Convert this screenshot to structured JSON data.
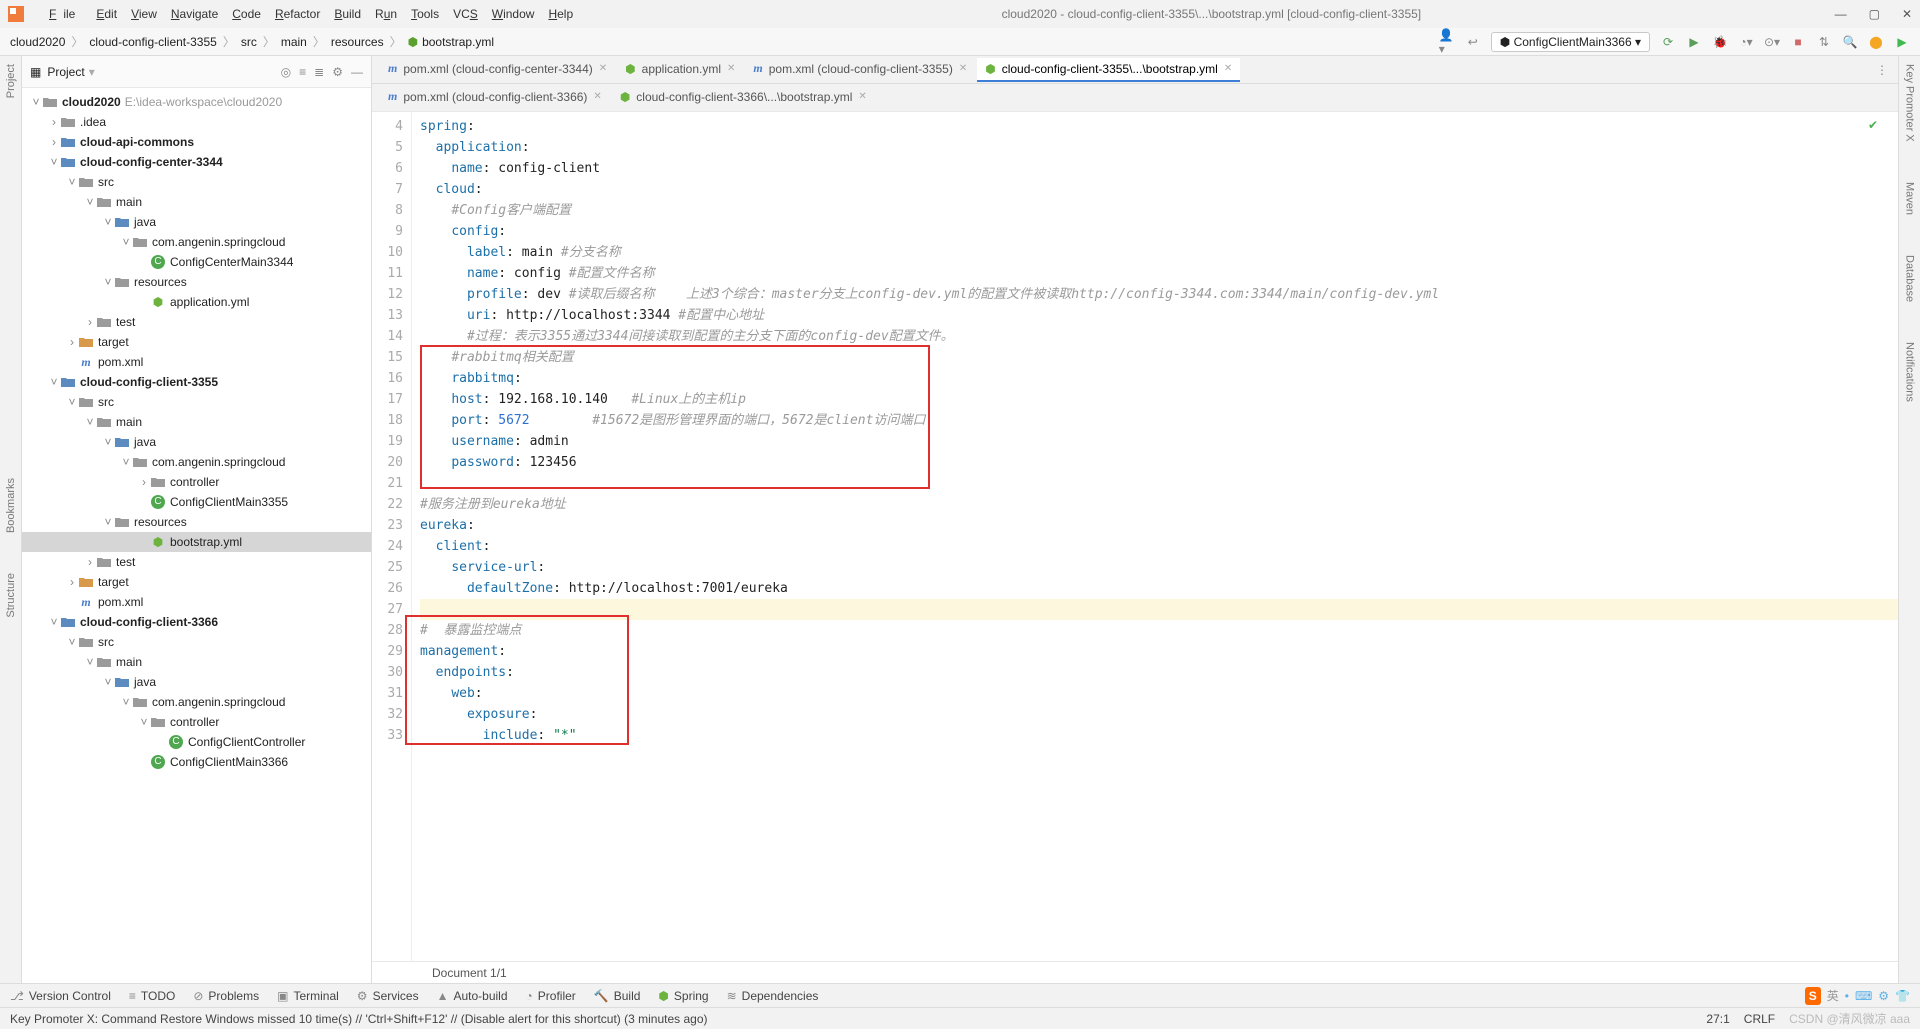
{
  "title": "cloud2020 - cloud-config-client-3355\\...\\bootstrap.yml [cloud-config-client-3355]",
  "menu": {
    "file": "File",
    "edit": "Edit",
    "view": "View",
    "navigate": "Navigate",
    "code": "Code",
    "refactor": "Refactor",
    "build": "Build",
    "run": "Run",
    "tools": "Tools",
    "vcs": "VCS",
    "window": "Window",
    "help": "Help"
  },
  "breadcrumb": [
    "cloud2020",
    "cloud-config-client-3355",
    "src",
    "main",
    "resources",
    "bootstrap.yml"
  ],
  "run_config": "ConfigClientMain3366",
  "project_header": "Project",
  "tree": {
    "root": "cloud2020",
    "root_path": "E:\\idea-workspace\\cloud2020",
    "items": [
      {
        "indent": 1,
        "arrow": ">",
        "icon": "folder-gray",
        "label": ".idea"
      },
      {
        "indent": 1,
        "arrow": ">",
        "icon": "folder-blue",
        "label": "cloud-api-commons",
        "bold": true
      },
      {
        "indent": 1,
        "arrow": "v",
        "icon": "folder-blue",
        "label": "cloud-config-center-3344",
        "bold": true
      },
      {
        "indent": 2,
        "arrow": "v",
        "icon": "folder-gray",
        "label": "src"
      },
      {
        "indent": 3,
        "arrow": "v",
        "icon": "folder-gray",
        "label": "main"
      },
      {
        "indent": 4,
        "arrow": "v",
        "icon": "folder-blue",
        "label": "java"
      },
      {
        "indent": 5,
        "arrow": "v",
        "icon": "folder-gray",
        "label": "com.angenin.springcloud"
      },
      {
        "indent": 6,
        "arrow": "",
        "icon": "c",
        "label": "ConfigCenterMain3344"
      },
      {
        "indent": 4,
        "arrow": "v",
        "icon": "folder-gray",
        "label": "resources"
      },
      {
        "indent": 6,
        "arrow": "",
        "icon": "leaf",
        "label": "application.yml"
      },
      {
        "indent": 3,
        "arrow": ">",
        "icon": "folder-gray",
        "label": "test"
      },
      {
        "indent": 2,
        "arrow": ">",
        "icon": "folder-brown",
        "label": "target"
      },
      {
        "indent": 2,
        "arrow": "",
        "icon": "m",
        "label": "pom.xml"
      },
      {
        "indent": 1,
        "arrow": "v",
        "icon": "folder-blue",
        "label": "cloud-config-client-3355",
        "bold": true
      },
      {
        "indent": 2,
        "arrow": "v",
        "icon": "folder-gray",
        "label": "src"
      },
      {
        "indent": 3,
        "arrow": "v",
        "icon": "folder-gray",
        "label": "main"
      },
      {
        "indent": 4,
        "arrow": "v",
        "icon": "folder-blue",
        "label": "java"
      },
      {
        "indent": 5,
        "arrow": "v",
        "icon": "folder-gray",
        "label": "com.angenin.springcloud"
      },
      {
        "indent": 6,
        "arrow": ">",
        "icon": "folder-gray",
        "label": "controller"
      },
      {
        "indent": 6,
        "arrow": "",
        "icon": "c",
        "label": "ConfigClientMain3355"
      },
      {
        "indent": 4,
        "arrow": "v",
        "icon": "folder-gray",
        "label": "resources"
      },
      {
        "indent": 6,
        "arrow": "",
        "icon": "leaf",
        "label": "bootstrap.yml",
        "selected": true
      },
      {
        "indent": 3,
        "arrow": ">",
        "icon": "folder-gray",
        "label": "test"
      },
      {
        "indent": 2,
        "arrow": ">",
        "icon": "folder-brown",
        "label": "target"
      },
      {
        "indent": 2,
        "arrow": "",
        "icon": "m",
        "label": "pom.xml"
      },
      {
        "indent": 1,
        "arrow": "v",
        "icon": "folder-blue",
        "label": "cloud-config-client-3366",
        "bold": true
      },
      {
        "indent": 2,
        "arrow": "v",
        "icon": "folder-gray",
        "label": "src"
      },
      {
        "indent": 3,
        "arrow": "v",
        "icon": "folder-gray",
        "label": "main"
      },
      {
        "indent": 4,
        "arrow": "v",
        "icon": "folder-blue",
        "label": "java"
      },
      {
        "indent": 5,
        "arrow": "v",
        "icon": "folder-gray",
        "label": "com.angenin.springcloud"
      },
      {
        "indent": 6,
        "arrow": "v",
        "icon": "folder-gray",
        "label": "controller"
      },
      {
        "indent": 7,
        "arrow": "",
        "icon": "c",
        "label": "ConfigClientController"
      },
      {
        "indent": 6,
        "arrow": "",
        "icon": "c",
        "label": "ConfigClientMain3366"
      }
    ]
  },
  "tabs1": [
    {
      "icon": "m",
      "label": "pom.xml (cloud-config-center-3344)"
    },
    {
      "icon": "leaf",
      "label": "application.yml"
    },
    {
      "icon": "m",
      "label": "pom.xml (cloud-config-client-3355)"
    },
    {
      "icon": "leaf",
      "label": "cloud-config-client-3355\\...\\bootstrap.yml",
      "active": true
    }
  ],
  "tabs2": [
    {
      "icon": "m",
      "label": "pom.xml (cloud-config-client-3366)"
    },
    {
      "icon": "leaf",
      "label": "cloud-config-client-3366\\...\\bootstrap.yml"
    }
  ],
  "code_lines_start": 4,
  "code_lines": [
    "<k>spring</k>:",
    "  <k>application</k>:",
    "    <k>name</k>: config-client",
    "  <k>cloud</k>:",
    "    <c>#Config客户端配置</c>",
    "    <k>config</k>:",
    "      <k>label</k>: main <c>#分支名称</c>",
    "      <k>name</k>: config <c>#配置文件名称</c>",
    "      <k>profile</k>: dev <c>#读取后缀名称    上述3个综合：master分支上config-dev.yml的配置文件被读取http://config-3344.com:3344/main/config-dev.yml</c>",
    "      <k>uri</k>: http://localhost:3344 <c>#配置中心地址</c>",
    "      <c>#过程：表示3355通过3344间接读取到配置的主分支下面的config-dev配置文件。</c>",
    "    <c>#rabbitmq相关配置</c>",
    "    <k>rabbitmq</k>:",
    "    <k>host</k>: 192.168.10.140   <c>#Linux上的主机ip</c>",
    "    <k>port</k>: <num>5672</num>        <c>#15672是图形管理界面的端口，5672是client访问端口</c>",
    "    <k>username</k>: admin",
    "    <k>password</k>: 123456",
    "",
    "<c>#服务注册到eureka地址</c>",
    "<k>eureka</k>:",
    "  <k>client</k>:",
    "    <k>service-url</k>:",
    "      <k>defaultZone</k>: http://localhost:7001/eureka",
    "",
    "<c>#  暴露监控端点</c>",
    "<k>management</k>:",
    "  <k>endpoints</k>:",
    "    <k>web</k>:",
    "      <k>exposure</k>:",
    "        <k>include</k>: <s>\"*\"</s>"
  ],
  "editor_status": "Document 1/1",
  "bottom_tools": [
    "Version Control",
    "TODO",
    "Problems",
    "Terminal",
    "Services",
    "Auto-build",
    "Profiler",
    "Build",
    "Spring",
    "Dependencies"
  ],
  "footer_msg": "Key Promoter X: Command Restore Windows missed 10 time(s) // 'Ctrl+Shift+F12' // (Disable alert for this shortcut) (3 minutes ago)",
  "footer_pos": "27:1",
  "footer_enc": "CRLF",
  "watermark": "CSDN @清风微凉 aaa",
  "left_tools": [
    "Project",
    "Bookmarks",
    "Structure"
  ],
  "right_tools": [
    "Key Promoter X",
    "Maven",
    "Database",
    "Notifications"
  ]
}
